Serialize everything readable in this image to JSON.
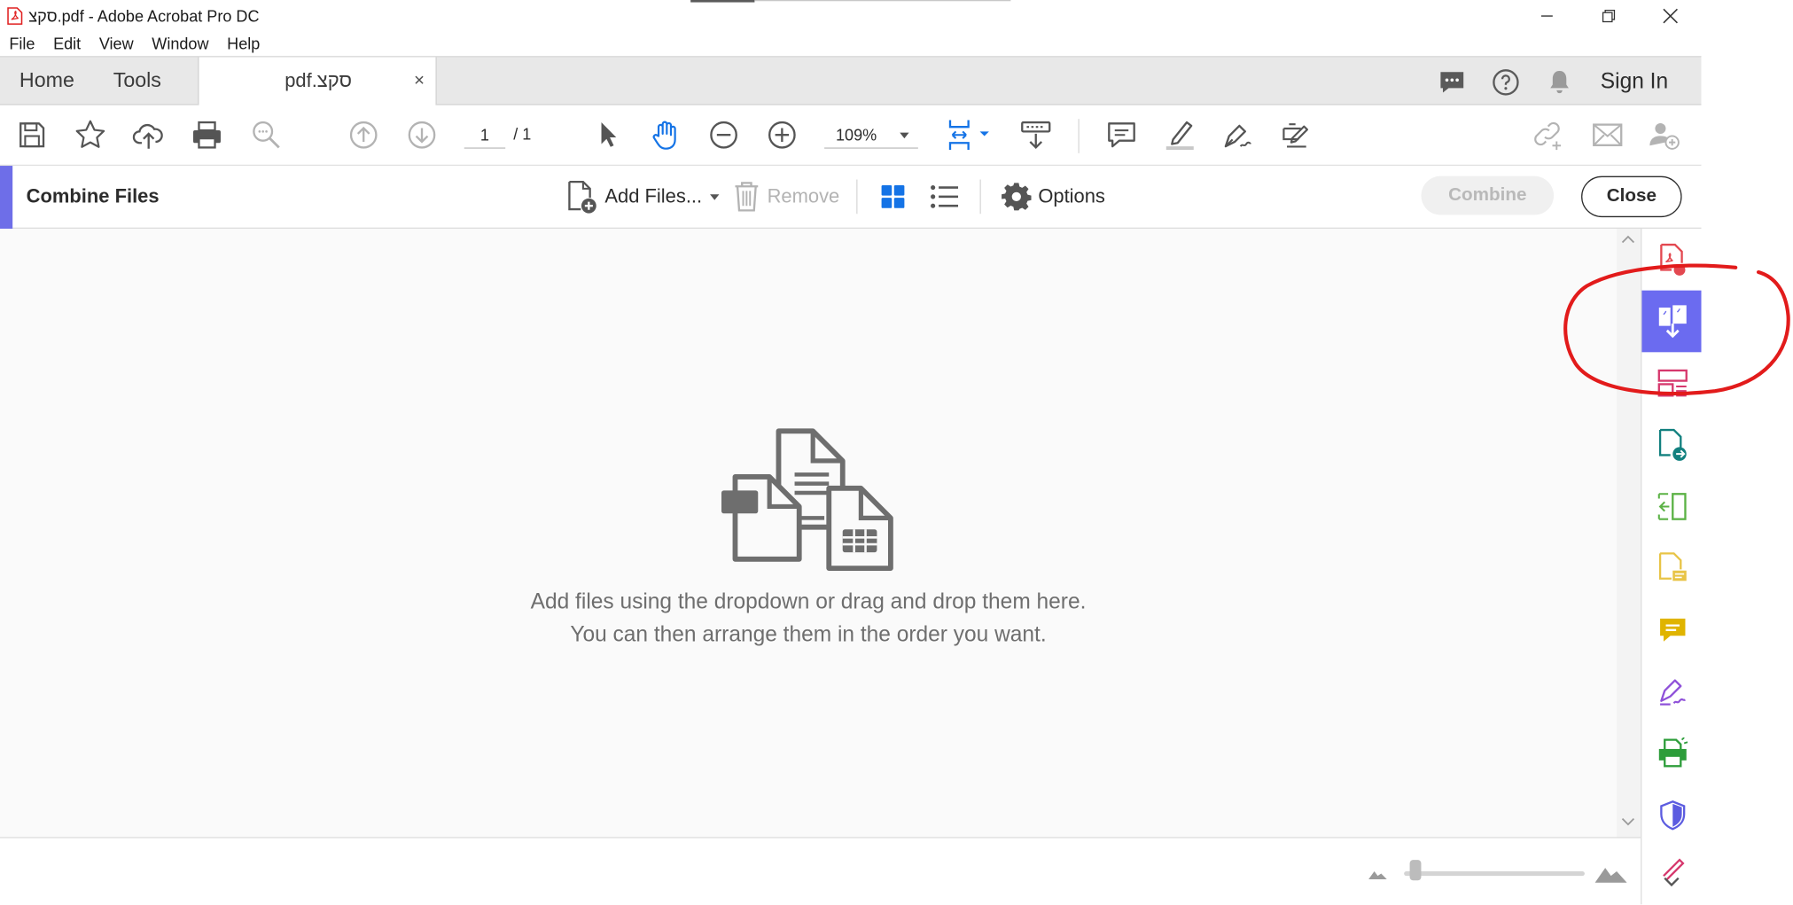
{
  "window": {
    "title": "סקצ.pdf - Adobe Acrobat Pro DC"
  },
  "menu": [
    "File",
    "Edit",
    "View",
    "Window",
    "Help"
  ],
  "tabs": {
    "home": "Home",
    "tools": "Tools",
    "document": "pdf.סקצ",
    "close_glyph": "×"
  },
  "header_right": {
    "sign_in": "Sign In"
  },
  "toolbar": {
    "page_current": "1",
    "page_total": "/ 1",
    "zoom_value": "109%"
  },
  "combine_bar": {
    "title": "Combine Files",
    "add_files": "Add Files...",
    "remove": "Remove",
    "options": "Options",
    "combine": "Combine",
    "close": "Close"
  },
  "content": {
    "hint_line1": "Add files using the dropdown or drag and drop them here.",
    "hint_line2": "You can then arrange them in the order you want."
  },
  "right_panel": {
    "items": [
      {
        "name": "export-pdf-icon",
        "color": "#e34850",
        "active": false
      },
      {
        "name": "combine-files-icon",
        "color": "#6b6bf0",
        "active": true
      },
      {
        "name": "organize-pages-icon",
        "color": "#d6386d",
        "active": false
      },
      {
        "name": "create-pdf-icon",
        "color": "#12807f",
        "active": false
      },
      {
        "name": "export-pages-icon",
        "color": "#5bb245",
        "active": false
      },
      {
        "name": "edit-pdf-icon",
        "color": "#e8c446",
        "active": false
      },
      {
        "name": "comment-icon",
        "color": "#e0b400",
        "active": false
      },
      {
        "name": "fill-sign-icon",
        "color": "#8f51d9",
        "active": false
      },
      {
        "name": "print-production-icon",
        "color": "#2d9d3a",
        "active": false
      },
      {
        "name": "protect-icon",
        "color": "#5c5ce0",
        "active": false
      },
      {
        "name": "more-tools-icon",
        "color": "#d6386d",
        "active": false
      }
    ]
  },
  "colors": {
    "accent": "#6b6bf0",
    "annotation": "#e21b1b",
    "toolbar_icon": "#555555",
    "disabled_icon": "#b3b3b3",
    "blue_icon": "#1473e6"
  }
}
